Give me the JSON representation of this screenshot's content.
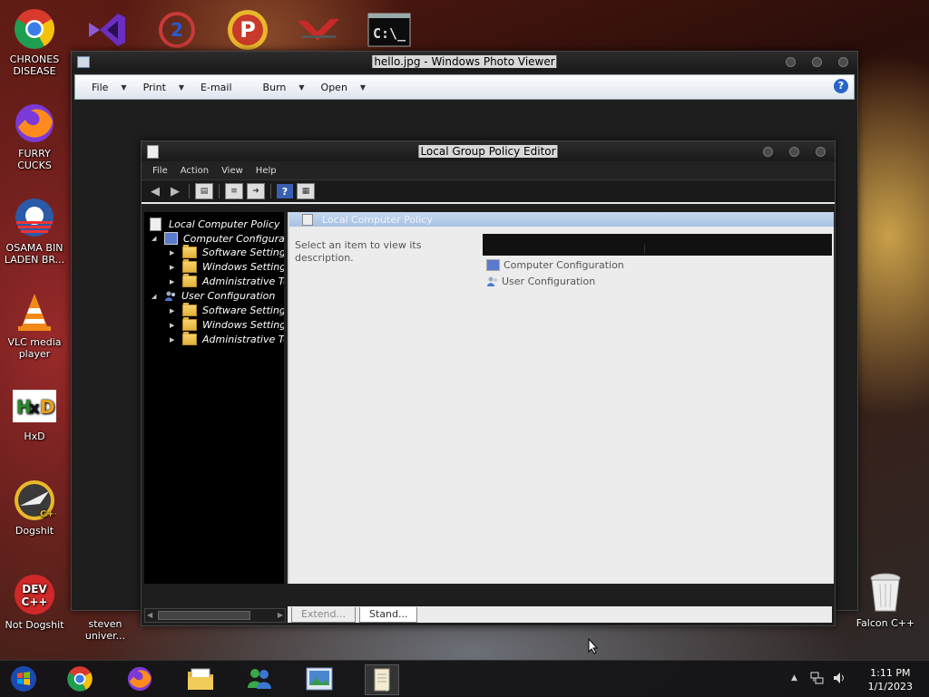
{
  "desktop_icons": [
    {
      "label": "CHRONES DISEASE"
    },
    {
      "label": "FURRY CUCKS"
    },
    {
      "label": "OSAMA BIN LADEN BR..."
    },
    {
      "label": "VLC media player"
    },
    {
      "label": "HxD"
    },
    {
      "label": "Dogshit"
    },
    {
      "label": "Not Dogshit"
    },
    {
      "label": "steven univer..."
    },
    {
      "label": "Falcon C++"
    }
  ],
  "photo_viewer": {
    "title": "hello.jpg - Windows Photo Viewer",
    "menu": [
      "File",
      "Print",
      "E-mail",
      "Burn",
      "Open"
    ]
  },
  "gpe": {
    "title": "Local Group Policy Editor",
    "menu": [
      "File",
      "Action",
      "View",
      "Help"
    ],
    "tree": {
      "root": "Local Computer Policy",
      "computer": "Computer Configuration",
      "user": "User Configuration",
      "software": "Software Settings",
      "windows": "Windows Settings",
      "admin": "Administrative Templates"
    },
    "content_title": "Local Computer Policy",
    "description": "Select an item to view its description.",
    "items": [
      "Computer Configuration",
      "User Configuration"
    ],
    "tabs": [
      "Extend...",
      "Stand..."
    ]
  },
  "taskbar": {
    "time": "1:11 PM",
    "date": "1/1/2023"
  }
}
